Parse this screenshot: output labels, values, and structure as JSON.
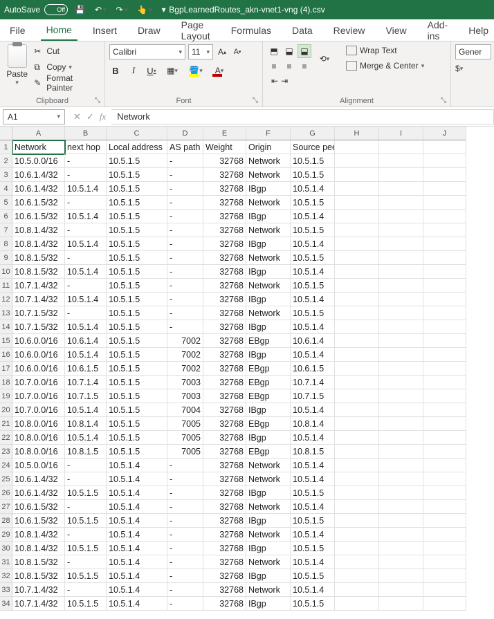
{
  "titlebar": {
    "autosave_label": "AutoSave",
    "autosave_state": "Off",
    "filename": "BgpLearnedRoutes_akn-vnet1-vng (4).csv"
  },
  "tabs": [
    "File",
    "Home",
    "Insert",
    "Draw",
    "Page Layout",
    "Formulas",
    "Data",
    "Review",
    "View",
    "Add-ins",
    "Help"
  ],
  "active_tab": "Home",
  "clipboard": {
    "paste": "Paste",
    "cut": "Cut",
    "copy": "Copy",
    "format_painter": "Format Painter",
    "group": "Clipboard"
  },
  "font": {
    "name": "Calibri",
    "size": "11",
    "group": "Font"
  },
  "alignment": {
    "wrap": "Wrap Text",
    "merge": "Merge & Center",
    "group": "Alignment"
  },
  "number": {
    "format": "Gener"
  },
  "namebox": "A1",
  "formula": "Network",
  "columns": [
    "A",
    "B",
    "C",
    "D",
    "E",
    "F",
    "G",
    "H",
    "I",
    "J"
  ],
  "col_classes": [
    "cA",
    "cB",
    "cC",
    "cD",
    "cE",
    "cF",
    "cG",
    "cH",
    "cI",
    "cJ"
  ],
  "rows": [
    [
      "Network",
      "next hop",
      "Local address",
      "AS path",
      "Weight",
      "Origin",
      "Source peer",
      "",
      "",
      ""
    ],
    [
      "10.5.0.0/16",
      "-",
      "10.5.1.5",
      "-",
      "32768",
      "Network",
      "10.5.1.5",
      "",
      "",
      ""
    ],
    [
      "10.6.1.4/32",
      "-",
      "10.5.1.5",
      "-",
      "32768",
      "Network",
      "10.5.1.5",
      "",
      "",
      ""
    ],
    [
      "10.6.1.4/32",
      "10.5.1.4",
      "10.5.1.5",
      "-",
      "32768",
      "IBgp",
      "10.5.1.4",
      "",
      "",
      ""
    ],
    [
      "10.6.1.5/32",
      "-",
      "10.5.1.5",
      "-",
      "32768",
      "Network",
      "10.5.1.5",
      "",
      "",
      ""
    ],
    [
      "10.6.1.5/32",
      "10.5.1.4",
      "10.5.1.5",
      "-",
      "32768",
      "IBgp",
      "10.5.1.4",
      "",
      "",
      ""
    ],
    [
      "10.8.1.4/32",
      "-",
      "10.5.1.5",
      "-",
      "32768",
      "Network",
      "10.5.1.5",
      "",
      "",
      ""
    ],
    [
      "10.8.1.4/32",
      "10.5.1.4",
      "10.5.1.5",
      "-",
      "32768",
      "IBgp",
      "10.5.1.4",
      "",
      "",
      ""
    ],
    [
      "10.8.1.5/32",
      "-",
      "10.5.1.5",
      "-",
      "32768",
      "Network",
      "10.5.1.5",
      "",
      "",
      ""
    ],
    [
      "10.8.1.5/32",
      "10.5.1.4",
      "10.5.1.5",
      "-",
      "32768",
      "IBgp",
      "10.5.1.4",
      "",
      "",
      ""
    ],
    [
      "10.7.1.4/32",
      "-",
      "10.5.1.5",
      "-",
      "32768",
      "Network",
      "10.5.1.5",
      "",
      "",
      ""
    ],
    [
      "10.7.1.4/32",
      "10.5.1.4",
      "10.5.1.5",
      "-",
      "32768",
      "IBgp",
      "10.5.1.4",
      "",
      "",
      ""
    ],
    [
      "10.7.1.5/32",
      "-",
      "10.5.1.5",
      "-",
      "32768",
      "Network",
      "10.5.1.5",
      "",
      "",
      ""
    ],
    [
      "10.7.1.5/32",
      "10.5.1.4",
      "10.5.1.5",
      "-",
      "32768",
      "IBgp",
      "10.5.1.4",
      "",
      "",
      ""
    ],
    [
      "10.6.0.0/16",
      "10.6.1.4",
      "10.5.1.5",
      "7002",
      "32768",
      "EBgp",
      "10.6.1.4",
      "",
      "",
      ""
    ],
    [
      "10.6.0.0/16",
      "10.5.1.4",
      "10.5.1.5",
      "7002",
      "32768",
      "IBgp",
      "10.5.1.4",
      "",
      "",
      ""
    ],
    [
      "10.6.0.0/16",
      "10.6.1.5",
      "10.5.1.5",
      "7002",
      "32768",
      "EBgp",
      "10.6.1.5",
      "",
      "",
      ""
    ],
    [
      "10.7.0.0/16",
      "10.7.1.4",
      "10.5.1.5",
      "7003",
      "32768",
      "EBgp",
      "10.7.1.4",
      "",
      "",
      ""
    ],
    [
      "10.7.0.0/16",
      "10.7.1.5",
      "10.5.1.5",
      "7003",
      "32768",
      "EBgp",
      "10.7.1.5",
      "",
      "",
      ""
    ],
    [
      "10.7.0.0/16",
      "10.5.1.4",
      "10.5.1.5",
      "7004",
      "32768",
      "IBgp",
      "10.5.1.4",
      "",
      "",
      ""
    ],
    [
      "10.8.0.0/16",
      "10.8.1.4",
      "10.5.1.5",
      "7005",
      "32768",
      "EBgp",
      "10.8.1.4",
      "",
      "",
      ""
    ],
    [
      "10.8.0.0/16",
      "10.5.1.4",
      "10.5.1.5",
      "7005",
      "32768",
      "IBgp",
      "10.5.1.4",
      "",
      "",
      ""
    ],
    [
      "10.8.0.0/16",
      "10.8.1.5",
      "10.5.1.5",
      "7005",
      "32768",
      "EBgp",
      "10.8.1.5",
      "",
      "",
      ""
    ],
    [
      "10.5.0.0/16",
      "-",
      "10.5.1.4",
      "-",
      "32768",
      "Network",
      "10.5.1.4",
      "",
      "",
      ""
    ],
    [
      "10.6.1.4/32",
      "-",
      "10.5.1.4",
      "-",
      "32768",
      "Network",
      "10.5.1.4",
      "",
      "",
      ""
    ],
    [
      "10.6.1.4/32",
      "10.5.1.5",
      "10.5.1.4",
      "-",
      "32768",
      "IBgp",
      "10.5.1.5",
      "",
      "",
      ""
    ],
    [
      "10.6.1.5/32",
      "-",
      "10.5.1.4",
      "-",
      "32768",
      "Network",
      "10.5.1.4",
      "",
      "",
      ""
    ],
    [
      "10.6.1.5/32",
      "10.5.1.5",
      "10.5.1.4",
      "-",
      "32768",
      "IBgp",
      "10.5.1.5",
      "",
      "",
      ""
    ],
    [
      "10.8.1.4/32",
      "-",
      "10.5.1.4",
      "-",
      "32768",
      "Network",
      "10.5.1.4",
      "",
      "",
      ""
    ],
    [
      "10.8.1.4/32",
      "10.5.1.5",
      "10.5.1.4",
      "-",
      "32768",
      "IBgp",
      "10.5.1.5",
      "",
      "",
      ""
    ],
    [
      "10.8.1.5/32",
      "-",
      "10.5.1.4",
      "-",
      "32768",
      "Network",
      "10.5.1.4",
      "",
      "",
      ""
    ],
    [
      "10.8.1.5/32",
      "10.5.1.5",
      "10.5.1.4",
      "-",
      "32768",
      "IBgp",
      "10.5.1.5",
      "",
      "",
      ""
    ],
    [
      "10.7.1.4/32",
      "-",
      "10.5.1.4",
      "-",
      "32768",
      "Network",
      "10.5.1.4",
      "",
      "",
      ""
    ],
    [
      "10.7.1.4/32",
      "10.5.1.5",
      "10.5.1.4",
      "-",
      "32768",
      "IBgp",
      "10.5.1.5",
      "",
      "",
      ""
    ]
  ]
}
